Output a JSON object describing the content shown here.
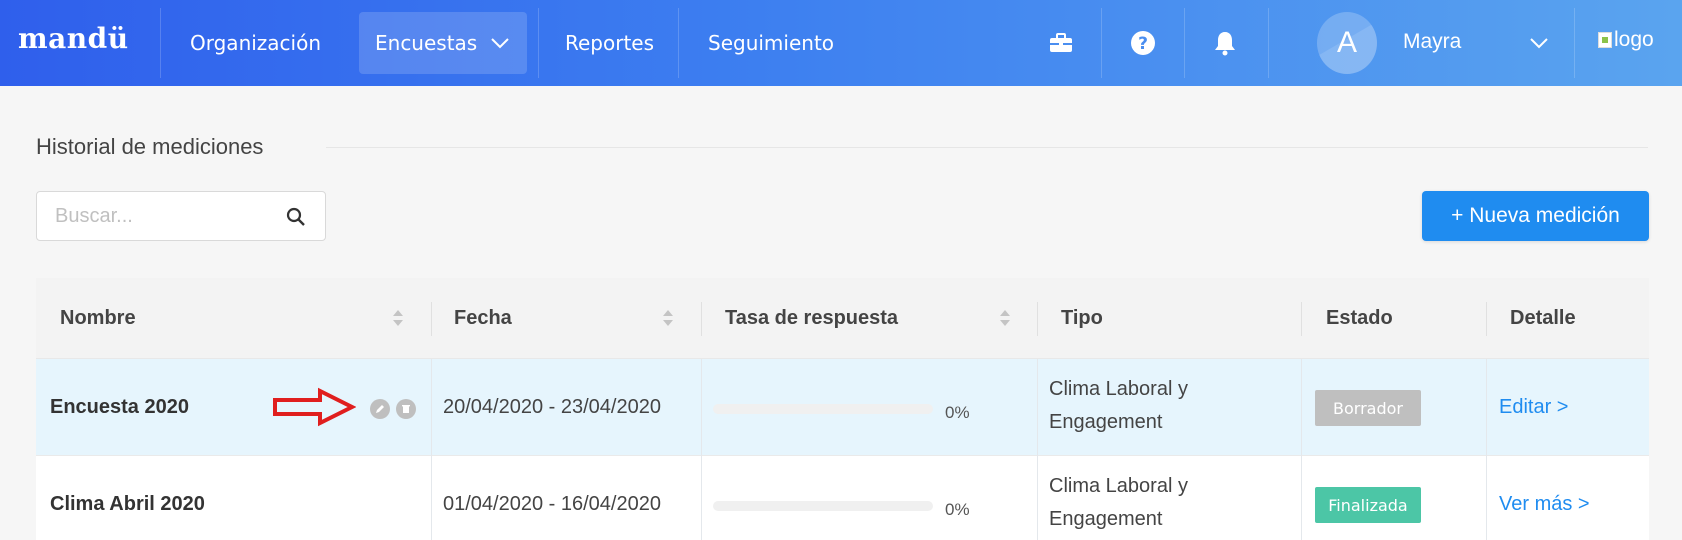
{
  "brand": "mandü",
  "nav": {
    "items": [
      {
        "label": "Organización"
      },
      {
        "label": "Encuestas"
      },
      {
        "label": "Reportes"
      },
      {
        "label": "Seguimiento"
      }
    ],
    "user": {
      "avatar_letter": "A",
      "name": "Mayra"
    },
    "logo_alt": "logo",
    "icons": [
      "briefcase-icon",
      "help-icon",
      "bell-icon"
    ]
  },
  "page": {
    "title": "Historial de mediciones",
    "search_placeholder": "Buscar...",
    "new_button": "+ Nueva medición"
  },
  "table": {
    "headers": [
      "Nombre",
      "Fecha",
      "Tasa de respuesta",
      "Tipo",
      "Estado",
      "Detalle"
    ],
    "rows": [
      {
        "name": "Encuesta 2020",
        "date": "20/04/2020 - 23/04/2020",
        "progress": 0,
        "percent": "0%",
        "tipo_line1": "Clima Laboral y",
        "tipo_line2": "Engagement",
        "status": "Borrador",
        "status_color": "#bfbfbf",
        "detail": "Editar >",
        "highlighted": true
      },
      {
        "name": "Clima Abril 2020",
        "date": "01/04/2020 - 16/04/2020",
        "progress": 0,
        "percent": "0%",
        "tipo_line1": "Clima Laboral y",
        "tipo_line2": "Engagement",
        "status": "Finalizada",
        "status_color": "#4cc6a6",
        "detail": "Ver más >",
        "highlighted": false
      }
    ]
  },
  "colors": {
    "accent": "#1f8cf0",
    "annotation_arrow": "#e01e1e"
  }
}
